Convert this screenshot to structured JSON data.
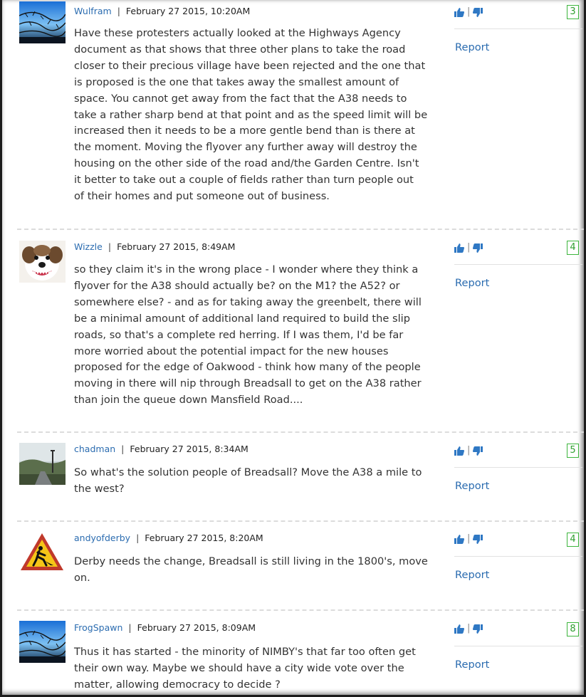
{
  "vote_separator": "|",
  "colors": {
    "link": "#2b6cb0",
    "score_border": "#3db53d",
    "text": "#333333"
  },
  "comments": [
    {
      "author": "Wulfram",
      "date": "February 27 2015, 10:20AM",
      "score": "3",
      "report_label": "Report",
      "avatar": "barbed-wire-sky-avatar",
      "text": "Have these protesters actually looked at the Highways Agency\ndocument as that shows that three other plans to take the road\ncloser to their precious village have been rejected and the one that\nis proposed is the one that takes away the smallest amount of\nspace. You cannot get away from the fact that the A38 needs to\ntake a rather sharp bend at that point and as the speed limit will be\nincreased then it needs to be a more gentle bend than is there at\nthe moment. Moving the flyover any further away will destroy the\nhousing on the other side of the road and/the Garden Centre. Isn't\nit better to take out a couple of fields rather than turn people out\nof their homes and put someone out of business."
    },
    {
      "author": "Wizzle",
      "date": "February 27 2015, 8:49AM",
      "score": "4",
      "report_label": "Report",
      "avatar": "dog-avatar",
      "text": "so they claim it's in the wrong place - I wonder where they think a\nflyover for the A38 should actually be? on the M1? the A52? or\nsomewhere else? - and as for taking away the greenbelt, there will\nbe a minimal amount of additional land required to build the slip\nroads, so that's a complete red herring. If I was them, I'd be far\nmore worried about the potential impact for the new houses\nproposed for the edge of Oakwood - think how many of the people\nmoving in there will nip through Breadsall to get on the A38 rather\nthan join the queue down Mansfield Road...."
    },
    {
      "author": "chadman",
      "date": "February 27 2015, 8:34AM",
      "score": "5",
      "report_label": "Report",
      "avatar": "road-landscape-avatar",
      "text": "So what's the solution people of Breadsall? Move the A38 a mile to\nthe west?"
    },
    {
      "author": "andyofderby",
      "date": "February 27 2015, 8:20AM",
      "score": "4",
      "report_label": "Report",
      "avatar": "roadworks-sign-avatar",
      "text": "Derby needs the change, Breadsall is still living in the 1800's, move\non."
    },
    {
      "author": "FrogSpawn",
      "date": "February 27 2015, 8:09AM",
      "score": "8",
      "report_label": "Report",
      "avatar": "barbed-wire-sky-avatar",
      "text": "Thus it has started - the minority of NIMBY's that far too often get\ntheir own way. Maybe we should have a city wide vote over the\nmatter, allowing democracy to decide ?"
    }
  ]
}
